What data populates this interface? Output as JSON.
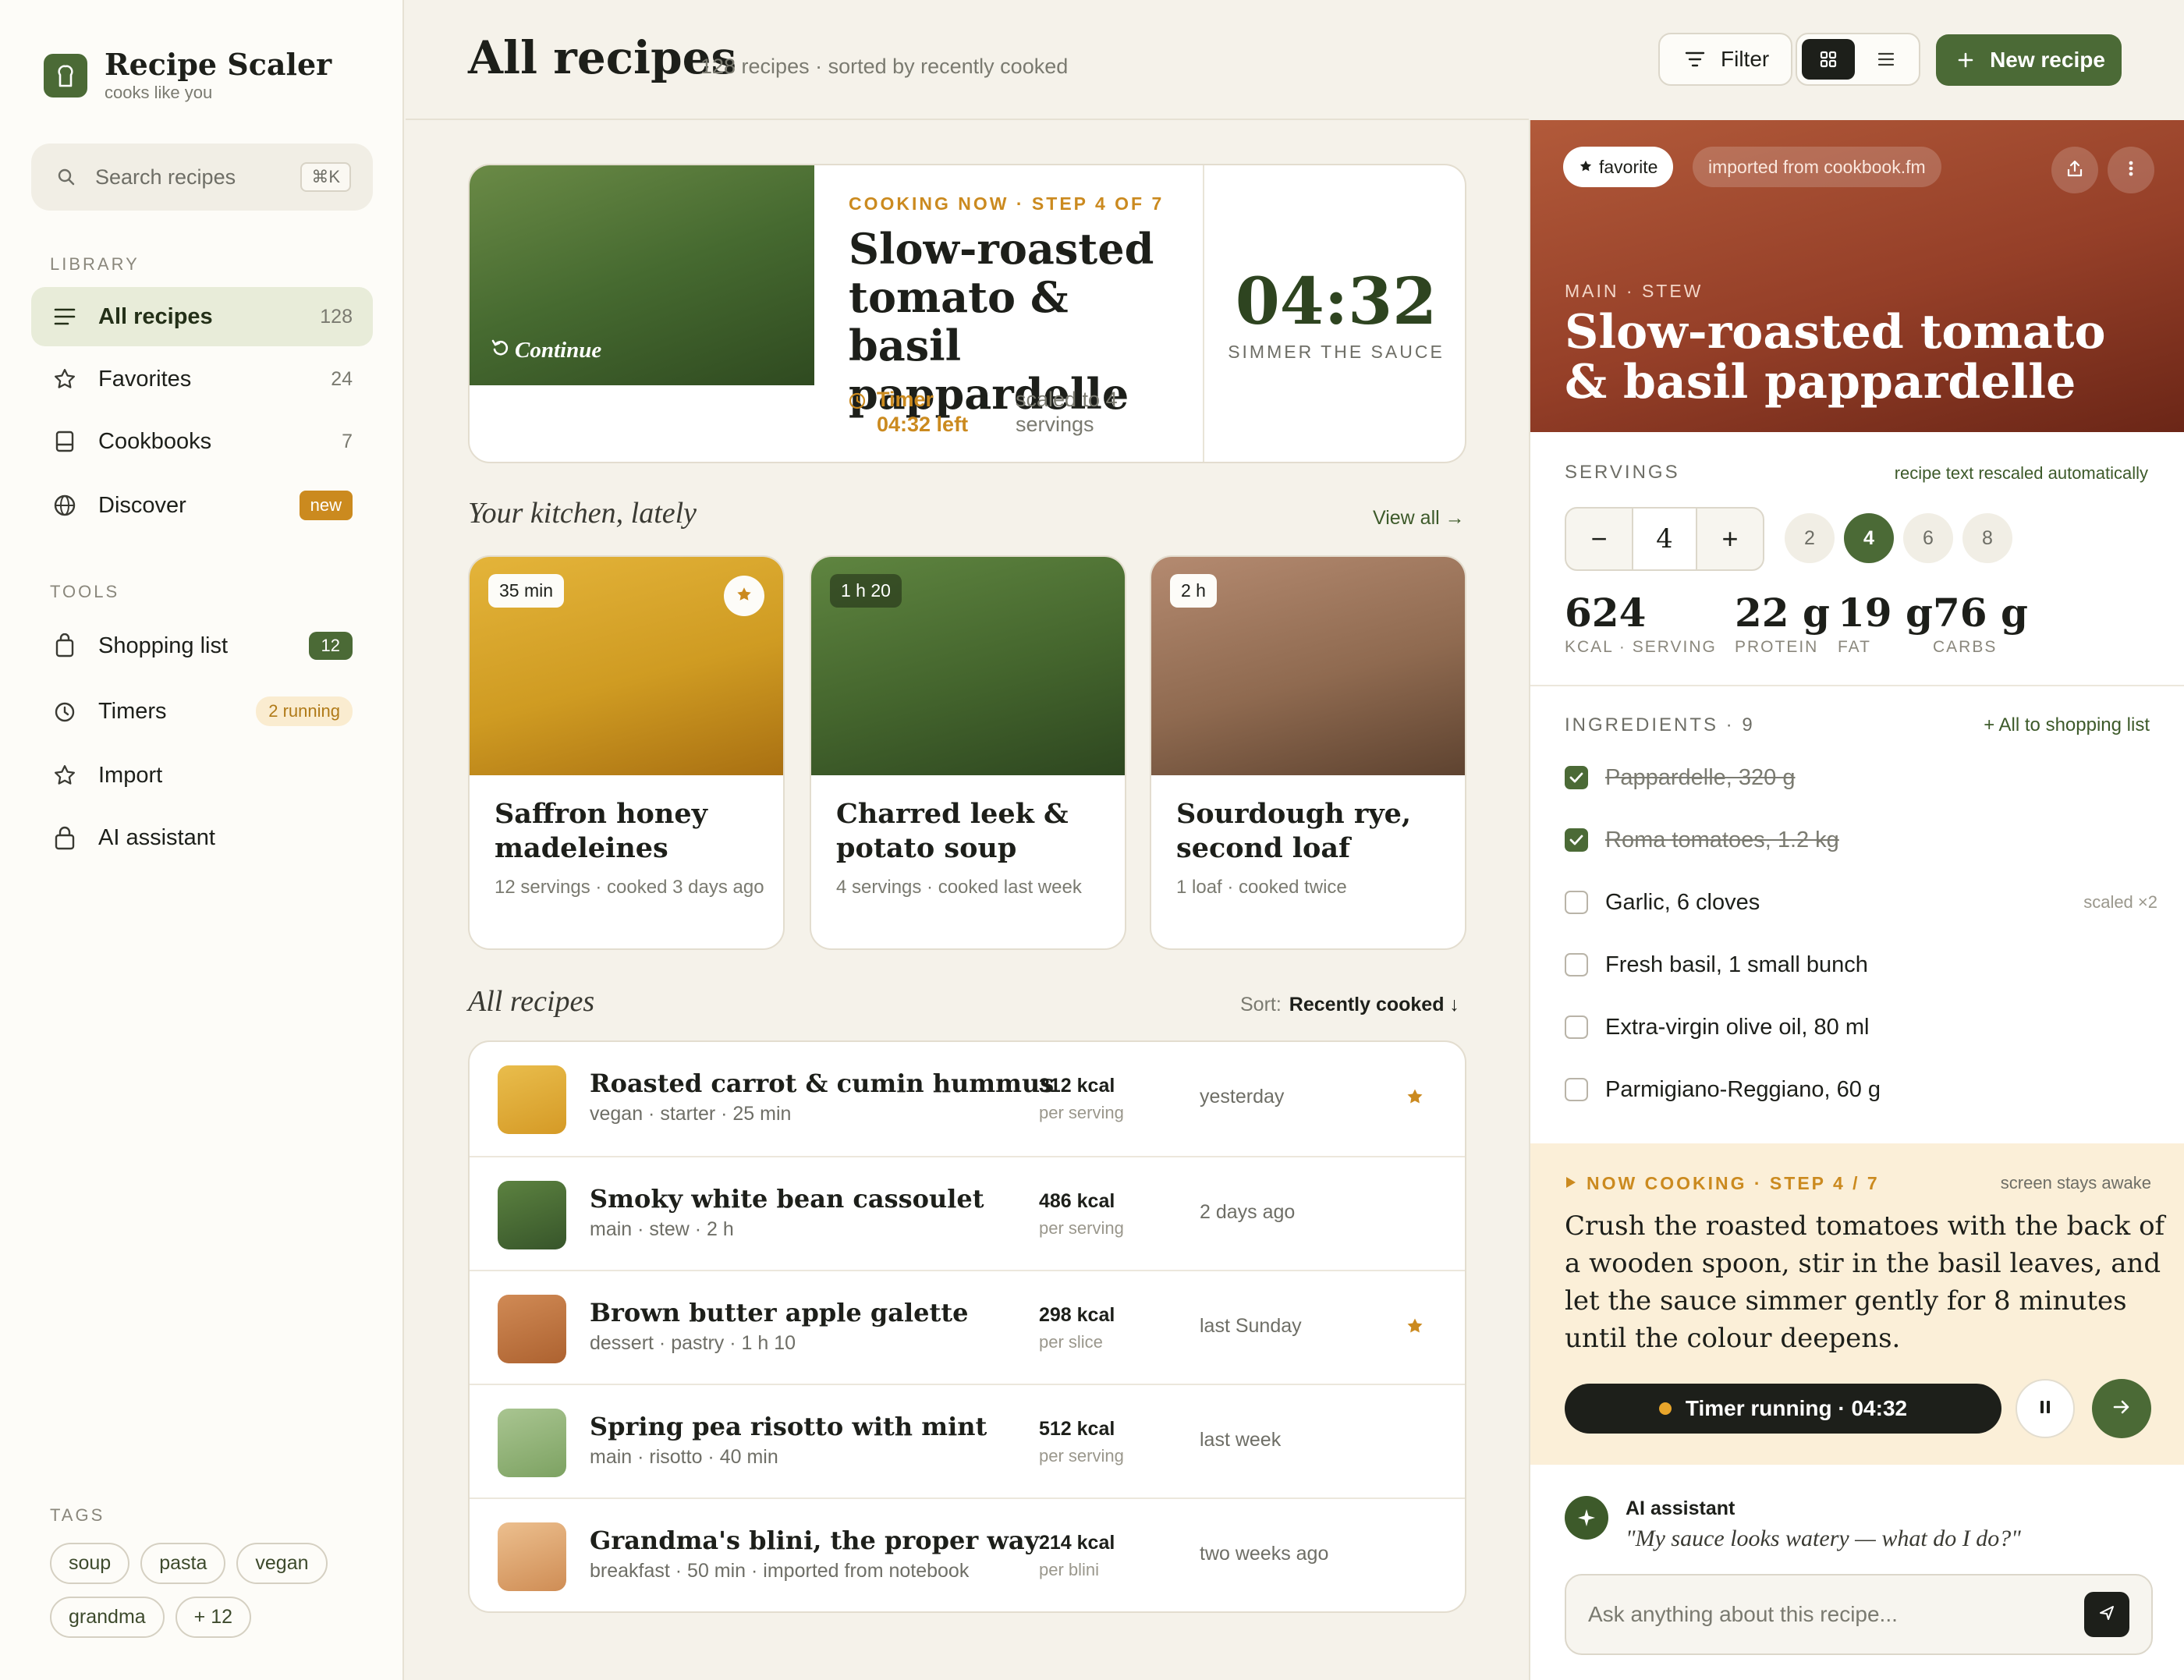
{
  "app": {
    "name": "Recipe Scaler",
    "tagline": "cooks like you"
  },
  "search": {
    "placeholder": "Search recipes",
    "shortcut": "⌘K"
  },
  "sidebar": {
    "library_label": "LIBRARY",
    "library": [
      {
        "label": "All recipes",
        "count": "128",
        "icon": "list-icon"
      },
      {
        "label": "Favorites",
        "count": "24",
        "icon": "star-icon"
      },
      {
        "label": "Cookbooks",
        "count": "7",
        "icon": "book-icon"
      },
      {
        "label": "Discover",
        "badge": "new",
        "icon": "globe-icon"
      }
    ],
    "tools_label": "TOOLS",
    "tools": [
      {
        "label": "Shopping list",
        "badge": "12",
        "icon": "bag-icon"
      },
      {
        "label": "Timers",
        "badge": "2 running",
        "icon": "timer-icon"
      },
      {
        "label": "Import",
        "icon": "star-icon"
      },
      {
        "label": "AI assistant",
        "icon": "lock-icon"
      }
    ],
    "tags_label": "TAGS",
    "tags": [
      "soup",
      "pasta",
      "vegan",
      "grandma",
      "+ 12"
    ]
  },
  "header": {
    "title": "All recipes",
    "subtitle": "128 recipes · sorted by recently cooked",
    "filter_label": "Filter",
    "new_label": "New recipe"
  },
  "cooking_now": {
    "eyebrow": "COOKING NOW · STEP 4 OF 7",
    "title": "Slow-roasted tomato & basil pappardelle",
    "continue_label": "Continue",
    "timer_label": "Timer",
    "timer_left": "04:32 left",
    "scaled": "scaled to 4 servings",
    "clock": "04:32",
    "clock_label": "SIMMER THE SAUCE"
  },
  "lately": {
    "heading": "Your kitchen, lately",
    "view_all": "View all →",
    "cards": [
      {
        "time": "35 min",
        "title": "Saffron honey madeleines",
        "meta": "12 servings · cooked 3 days ago",
        "favorite": true
      },
      {
        "time": "1 h 20",
        "title": "Charred leek & potato soup",
        "meta": "4 servings · cooked last week",
        "favorite": false
      },
      {
        "time": "2 h",
        "title": "Sourdough rye, second loaf",
        "meta": "1 loaf · cooked twice",
        "favorite": false
      }
    ]
  },
  "all": {
    "heading": "All recipes",
    "sort_label": "Sort:",
    "sort_value": "Recently cooked ↓",
    "rows": [
      {
        "title": "Roasted carrot & cumin hummus",
        "meta": "vegan · starter · 25 min",
        "kcal": "312 kcal",
        "per": "per serving",
        "when": "yesterday",
        "favorite": true
      },
      {
        "title": "Smoky white bean cassoulet",
        "meta": "main · stew · 2 h",
        "kcal": "486 kcal",
        "per": "per serving",
        "when": "2 days ago",
        "favorite": false
      },
      {
        "title": "Brown butter apple galette",
        "meta": "dessert · pastry · 1 h 10",
        "kcal": "298 kcal",
        "per": "per slice",
        "when": "last Sunday",
        "favorite": true
      },
      {
        "title": "Spring pea risotto with mint",
        "meta": "main · risotto · 40 min",
        "kcal": "512 kcal",
        "per": "per serving",
        "when": "last week",
        "favorite": false
      },
      {
        "title": "Grandma's blini, the proper way",
        "meta": "breakfast · 50 min · imported from notebook",
        "kcal": "214 kcal",
        "per": "per blini",
        "when": "two weeks ago",
        "favorite": false
      }
    ]
  },
  "detail": {
    "favorite_pill": "favorite",
    "import_pill": "imported from cookbook.fm",
    "eyebrow": "MAIN · STEW",
    "title": "Slow-roasted tomato & basil pappardelle",
    "servings_label": "SERVINGS",
    "servings_note": "recipe text rescaled automatically",
    "servings_value": "4",
    "servings_presets": [
      "2",
      "4",
      "6",
      "8"
    ],
    "nutrition": [
      {
        "value": "624",
        "label": "KCAL · SERVING"
      },
      {
        "value": "22 g",
        "label": "PROTEIN"
      },
      {
        "value": "19 g",
        "label": "FAT"
      },
      {
        "value": "76 g",
        "label": "CARBS"
      }
    ],
    "ingredients_label": "INGREDIENTS · 9",
    "ingredients_action": "+ All to shopping list",
    "ingredients": [
      {
        "text": "Pappardelle, 320 g",
        "checked": true,
        "note": ""
      },
      {
        "text": "Roma tomatoes, 1.2 kg",
        "checked": true,
        "note": ""
      },
      {
        "text": "Garlic, 6 cloves",
        "checked": false,
        "note": "scaled ×2"
      },
      {
        "text": "Fresh basil, 1 small bunch",
        "checked": false,
        "note": ""
      },
      {
        "text": "Extra-virgin olive oil, 80 ml",
        "checked": false,
        "note": ""
      },
      {
        "text": "Parmigiano-Reggiano, 60 g",
        "checked": false,
        "note": ""
      }
    ],
    "step": {
      "eyebrow": "NOW COOKING · STEP 4 / 7",
      "awake": "screen stays awake",
      "text": "Crush the roasted tomatoes with the back of a wooden spoon, stir in the basil leaves, and let the sauce simmer gently for 8 minutes until the colour deepens.",
      "timer": "Timer running · 04:32"
    },
    "assistant": {
      "name": "AI assistant",
      "quote": "\"My sauce looks watery — what do I do?\"",
      "placeholder": "Ask anything about this recipe..."
    }
  },
  "colors": {
    "brand": "#4b6a36",
    "accent": "#cb8a1f",
    "hero": "#953f28",
    "cream": "#fbefd8"
  }
}
